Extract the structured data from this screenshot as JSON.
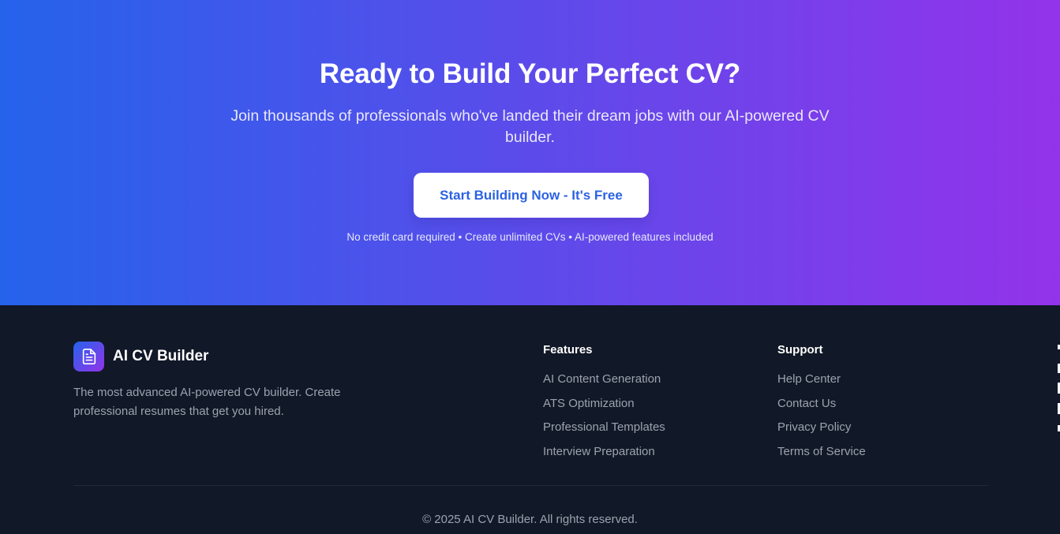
{
  "cta": {
    "title": "Ready to Build Your Perfect CV?",
    "subtitle": "Join thousands of professionals who've landed their dream jobs with our AI-powered CV builder.",
    "button_label": "Start Building Now - It's Free",
    "note": "No credit card required • Create unlimited CVs • AI-powered features included",
    "gradient": {
      "start": "#2563eb",
      "end": "#9333ea"
    }
  },
  "footer": {
    "brand": {
      "icon": "document-icon",
      "name": "AI CV Builder",
      "description": "The most advanced AI-powered CV builder. Create professional resumes that get you hired."
    },
    "columns": [
      {
        "title": "Features",
        "links": [
          "AI Content Generation",
          "ATS Optimization",
          "Professional Templates",
          "Interview Preparation"
        ]
      },
      {
        "title": "Support",
        "links": [
          "Help Center",
          "Contact Us",
          "Privacy Policy",
          "Terms of Service"
        ]
      }
    ],
    "copyright": "© 2025 AI CV Builder. All rights reserved."
  },
  "colors": {
    "footer_background": "#111827",
    "muted_text": "#9ca3af",
    "button_text": "#2b62e3"
  }
}
